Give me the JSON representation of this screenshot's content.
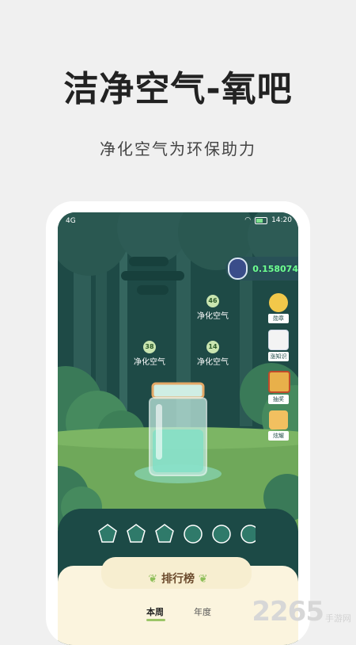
{
  "headline": "洁净空气-氧吧",
  "subline": "净化空气为环保助力",
  "status": {
    "left": "4G",
    "time": "14:20"
  },
  "player": {
    "score": "0.158074"
  },
  "bubbles": [
    {
      "count": "46",
      "label": "净化空气"
    },
    {
      "count": "38",
      "label": "净化空气"
    },
    {
      "count": "14",
      "label": "净化空气"
    }
  ],
  "side_buttons": [
    {
      "label": "勋章",
      "icon": "medal-icon"
    },
    {
      "label": "涨知识",
      "icon": "book-icon"
    },
    {
      "label": "抽奖",
      "icon": "lottery-icon"
    },
    {
      "label": "炫耀",
      "icon": "share-icon"
    }
  ],
  "rank": {
    "title": "排行榜",
    "tabs": [
      "本周",
      "年度"
    ]
  },
  "watermark": {
    "number": "2265",
    "text": "手游网"
  },
  "colors": {
    "forest_dark": "#1e4a46",
    "grass": "#6fa85a",
    "accent_green": "#6dff8f",
    "card_bg": "#fbf4de"
  }
}
